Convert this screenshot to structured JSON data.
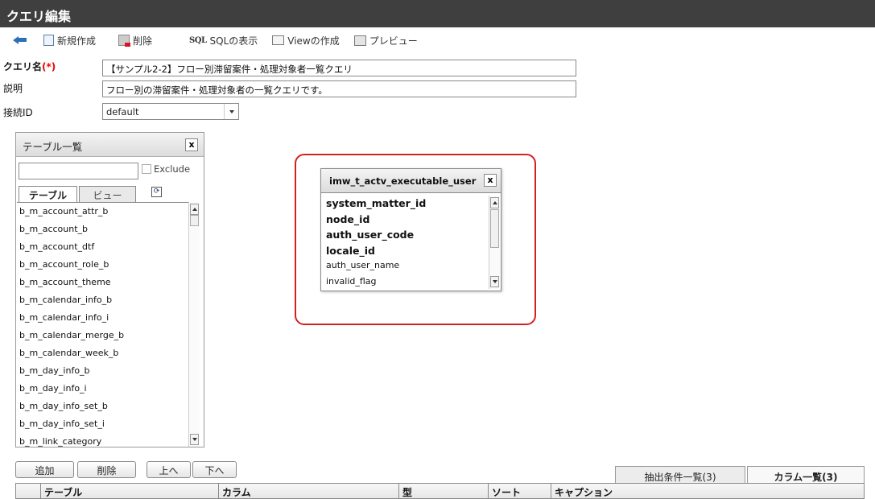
{
  "window": {
    "title": "クエリ編集"
  },
  "toolbar": {
    "new_label": "新規作成",
    "delete_label": "削除",
    "sql_icon_text": "SQL",
    "sql_label": "SQLの表示",
    "view_label": "Viewの作成",
    "preview_label": "プレビュー"
  },
  "form": {
    "query_name_label": "クエリ名",
    "required_mark": "(*)",
    "query_name_value": "【サンプル2-2】フロー別滞留案件・処理対象者一覧クエリ",
    "description_label": "説明",
    "description_value": "フロー別の滞留案件・処理対象者の一覧クエリです。",
    "connection_label": "接続ID",
    "connection_value": "default"
  },
  "table_panel": {
    "title": "テーブル一覧",
    "close_glyph": "x",
    "filter_value": "",
    "exclude_label": "Exclude",
    "tabs": [
      "テーブル",
      "ビュー"
    ],
    "refresh_glyph": "⟳",
    "items": [
      "b_m_account_attr_b",
      "b_m_account_b",
      "b_m_account_dtf",
      "b_m_account_role_b",
      "b_m_account_theme",
      "b_m_calendar_info_b",
      "b_m_calendar_info_i",
      "b_m_calendar_merge_b",
      "b_m_calendar_week_b",
      "b_m_day_info_b",
      "b_m_day_info_i",
      "b_m_day_info_set_b",
      "b_m_day_info_set_i",
      "b_m_link_category"
    ]
  },
  "table_box": {
    "title": "imw_t_actv_executable_user",
    "close_glyph": "x",
    "columns": [
      "system_matter_id",
      "node_id",
      "auth_user_code",
      "locale_id",
      "auth_user_name",
      "invalid_flag"
    ]
  },
  "bottom": {
    "buttons": [
      "追加",
      "削除",
      "上へ",
      "下へ"
    ],
    "tabs": [
      "抽出条件一覧(3)",
      "カラム一覧(3)"
    ],
    "grid_headers": [
      "テーブル",
      "カラム",
      "型",
      "ソート",
      "キャプション"
    ]
  }
}
